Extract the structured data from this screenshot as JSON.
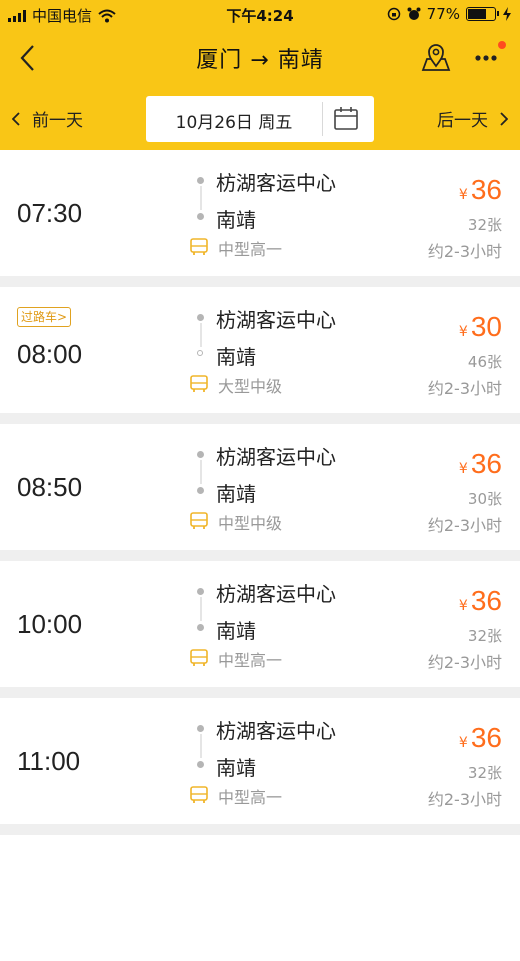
{
  "status_bar": {
    "carrier": "中国电信",
    "time": "下午4:24",
    "battery": "77%",
    "battery_level": 0.77
  },
  "nav": {
    "title": "厦门 → 南靖",
    "back_icon": "chevron-left-icon",
    "map_icon": "map-pin-icon",
    "more_icon": "more-dots-icon"
  },
  "date_bar": {
    "prev_label": "前一天",
    "next_label": "后一天",
    "date": "10月26日 周五",
    "calendar_icon": "calendar-icon"
  },
  "colors": {
    "header": "#f9c616",
    "price": "#ff6d1c",
    "tag": "#e09a14"
  },
  "trips": [
    {
      "time": "07:30",
      "tag": "",
      "from": "枋湖客运中心",
      "to": "南靖",
      "bus_type": "中型高一",
      "currency": "¥",
      "price": "36",
      "seats": "32张",
      "duration": "约2-3小时",
      "to_hollow": false
    },
    {
      "time": "08:00",
      "tag": "过路车>",
      "from": "枋湖客运中心",
      "to": "南靖",
      "bus_type": "大型中级",
      "currency": "¥",
      "price": "30",
      "seats": "46张",
      "duration": "约2-3小时",
      "to_hollow": true
    },
    {
      "time": "08:50",
      "tag": "",
      "from": "枋湖客运中心",
      "to": "南靖",
      "bus_type": "中型中级",
      "currency": "¥",
      "price": "36",
      "seats": "30张",
      "duration": "约2-3小时",
      "to_hollow": false
    },
    {
      "time": "10:00",
      "tag": "",
      "from": "枋湖客运中心",
      "to": "南靖",
      "bus_type": "中型高一",
      "currency": "¥",
      "price": "36",
      "seats": "32张",
      "duration": "约2-3小时",
      "to_hollow": false
    },
    {
      "time": "11:00",
      "tag": "",
      "from": "枋湖客运中心",
      "to": "南靖",
      "bus_type": "中型高一",
      "currency": "¥",
      "price": "36",
      "seats": "32张",
      "duration": "约2-3小时",
      "to_hollow": false
    }
  ]
}
